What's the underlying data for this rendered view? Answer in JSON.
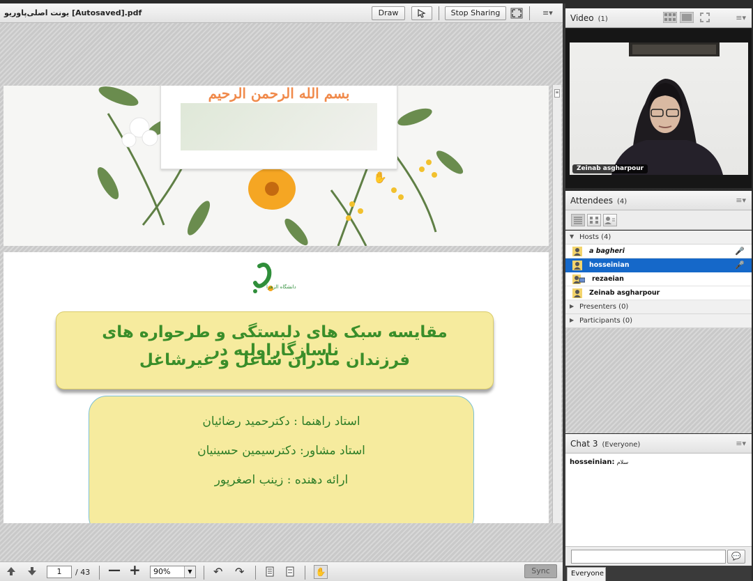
{
  "share": {
    "document_title": "یونت اصلی‌پاوریو [Autosaved].pdf",
    "draw_label": "Draw",
    "stop_sharing_label": "Stop Sharing",
    "menu_glyph": "≡▾"
  },
  "slide1": {
    "heading": "بسم الله الرحمن الرحیم"
  },
  "slide2": {
    "logo_text": "دانشگاه الزهرا",
    "title_line1": "مقایسه سبک های دلبستگی و طرحواره های ناسازگاراولیه در",
    "title_line2": "فرزندان مادران شاغل و غیرشاغل",
    "advisor": "استاد راهنما : دکترحمید رضائیان",
    "consultant": "استاد مشاور: دکترسیمین حسینیان",
    "presenter": "ارائه دهنده : زینب اصغرپور"
  },
  "toolbar": {
    "page_current": "1",
    "page_total": "/ 43",
    "zoom": "90%",
    "sync_label": "Sync"
  },
  "video": {
    "title": "Video",
    "count": "(1)",
    "camera_label": "Zeinab asgharpour"
  },
  "attendees": {
    "title": "Attendees",
    "count": "(4)",
    "hosts_label": "Hosts (4)",
    "presenters_label": "Presenters (0)",
    "participants_label": "Participants (0)",
    "hosts": [
      {
        "name": "a bagheri"
      },
      {
        "name": "hosseinian"
      },
      {
        "name": "rezaeian"
      },
      {
        "name": "Zeinab asgharpour"
      }
    ]
  },
  "chat": {
    "title": "Chat 3",
    "scope": "(Everyone)",
    "messages": [
      {
        "sender": "hosseinian:",
        "text": "سلام"
      }
    ],
    "tab_label": "Everyone",
    "send_glyph": "💬"
  },
  "colors": {
    "selection": "#1568c9",
    "title_green": "#3a8e2a",
    "box_yellow": "#f6eb9e",
    "basmala_orange": "#f08a4b"
  }
}
